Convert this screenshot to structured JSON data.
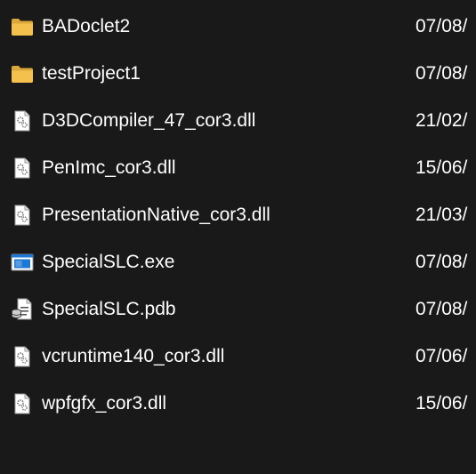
{
  "files": [
    {
      "name": "BADoclet2",
      "date": "07/08/",
      "icon": "folder-icon"
    },
    {
      "name": "testProject1",
      "date": "07/08/",
      "icon": "folder-icon"
    },
    {
      "name": "D3DCompiler_47_cor3.dll",
      "date": "21/02/",
      "icon": "dll-file-icon"
    },
    {
      "name": "PenImc_cor3.dll",
      "date": "15/06/",
      "icon": "dll-file-icon"
    },
    {
      "name": "PresentationNative_cor3.dll",
      "date": "21/03/",
      "icon": "dll-file-icon"
    },
    {
      "name": "SpecialSLC.exe",
      "date": "07/08/",
      "icon": "exe-file-icon"
    },
    {
      "name": "SpecialSLC.pdb",
      "date": "07/08/",
      "icon": "pdb-file-icon"
    },
    {
      "name": "vcruntime140_cor3.dll",
      "date": "07/06/",
      "icon": "dll-file-icon"
    },
    {
      "name": "wpfgfx_cor3.dll",
      "date": "15/06/",
      "icon": "dll-file-icon"
    }
  ],
  "colors": {
    "background": "#191919",
    "text": "#ffffff",
    "folder": "#f4c04e",
    "folder_dark": "#dba83a",
    "exe_accent": "#1e78d6"
  }
}
